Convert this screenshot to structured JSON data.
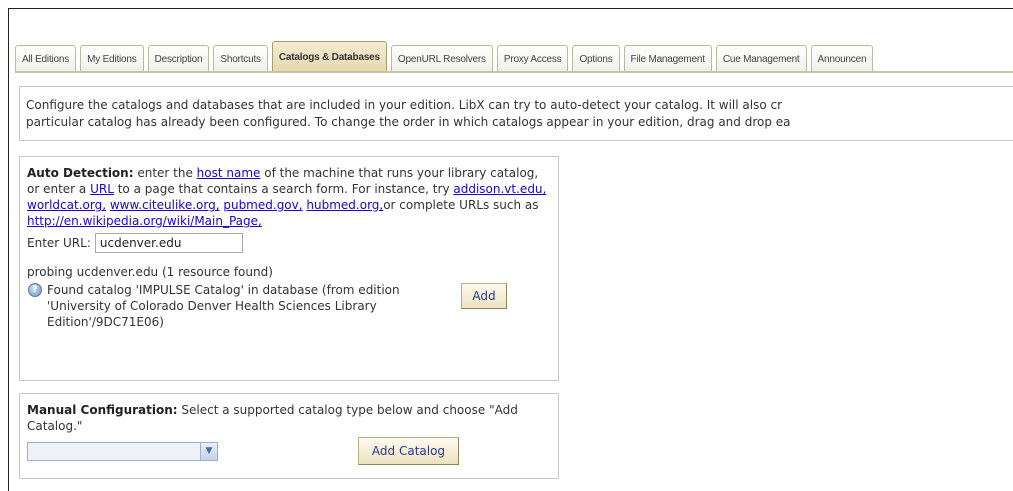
{
  "tabs": [
    {
      "label": "All Editions",
      "active": false
    },
    {
      "label": "My Editions",
      "active": false
    },
    {
      "label": "Description",
      "active": false
    },
    {
      "label": "Shortcuts",
      "active": false
    },
    {
      "label": "Catalogs & Databases",
      "active": true
    },
    {
      "label": "OpenURL Resolvers",
      "active": false
    },
    {
      "label": "Proxy Access",
      "active": false
    },
    {
      "label": "Options",
      "active": false
    },
    {
      "label": "File Management",
      "active": false
    },
    {
      "label": "Cue Management",
      "active": false
    },
    {
      "label": "Announcen",
      "active": false
    }
  ],
  "intro": {
    "line1": "Configure the catalogs and databases that are included in your edition. LibX can try to auto-detect your catalog. It will also cr",
    "line2": "particular catalog has already been configured. To change the order in which catalogs appear in your edition, drag and drop ea"
  },
  "auto_detection": {
    "label": "Auto Detection:",
    "t1": " enter the ",
    "host_link": "host name",
    "t2": " of the machine that runs your library catalog, or enter a ",
    "url_link": "URL",
    "t3": " to a page that contains a search form. For instance, try ",
    "ex1": "addison.vt.edu,",
    "ex2": "worldcat.org,",
    "ex3": "www.citeulike.org,",
    "ex4": "pubmed.gov,",
    "ex5": "hubmed.org,",
    "t4": "or complete URLs such as ",
    "ex6": "http://en.wikipedia.org/wiki/Main_Page,",
    "enter_url_label": "Enter URL:",
    "url_value": "ucdenver.edu",
    "probe_status": "probing ucdenver.edu (1 resource found)",
    "found_text": "Found catalog 'IMPULSE Catalog' in database (from edition 'University of Colorado Denver Health Sciences Library Edition'/9DC71E06)",
    "add_button": "Add"
  },
  "manual_configuration": {
    "label": "Manual Configuration:",
    "text": " Select a supported catalog type below and choose \"Add Catalog.\"",
    "selected": "",
    "add_button": "Add Catalog"
  },
  "colors": {
    "active_tab": "#e6d7ae",
    "link": "#2200cc",
    "button_text": "#2a3a8a"
  }
}
